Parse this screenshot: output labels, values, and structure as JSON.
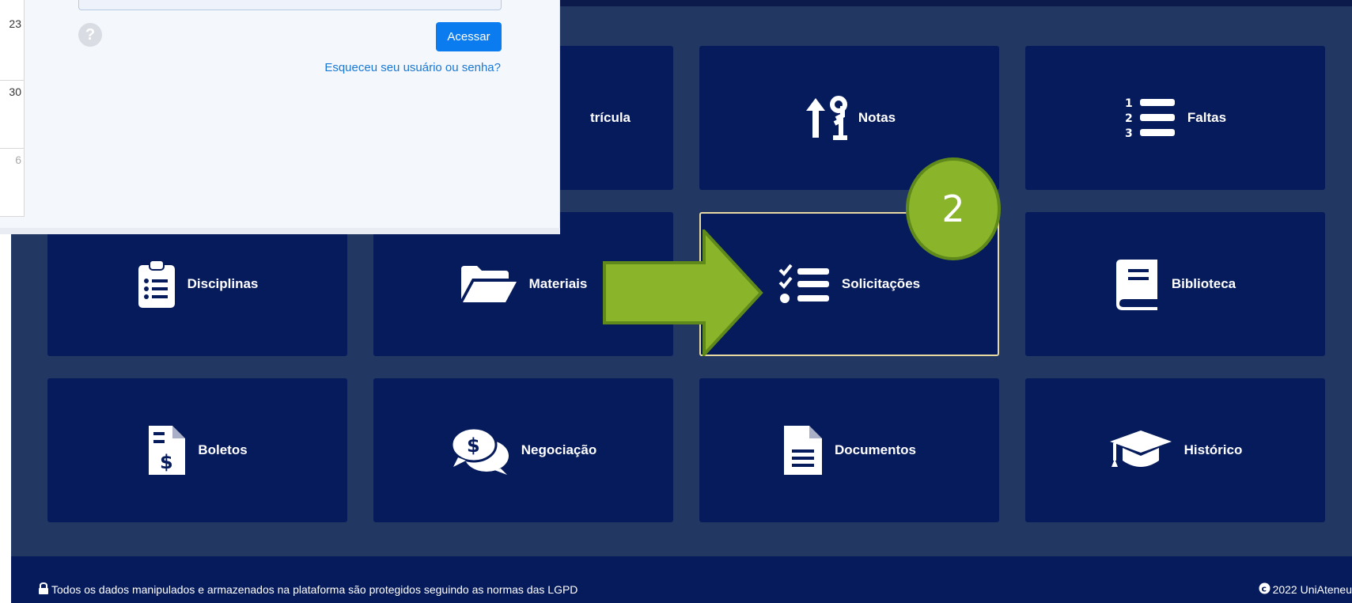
{
  "popup": {
    "calendar_days": [
      "23",
      "30",
      "6"
    ],
    "submit_label": "Acessar",
    "help_symbol": "?",
    "forgot_link": "Esqueceu seu usuário ou senha?"
  },
  "tiles": {
    "matricula": "trícula",
    "notas": "Notas",
    "faltas": "Faltas",
    "disciplinas": "Disciplinas",
    "materiais": "Materiais",
    "solicitacoes": "Solicitações",
    "biblioteca": "Biblioteca",
    "boletos": "Boletos",
    "negociacao": "Negociação",
    "documentos": "Documentos",
    "historico": "Histórico"
  },
  "annotation": {
    "step_number": "2",
    "color": "#8ab52a"
  },
  "footer": {
    "privacy_text": "Todos os dados manipulados e armazenados na plataforma são protegidos seguindo as normas das LGPD",
    "copyright_text": "2022 UniAteneu"
  },
  "colors": {
    "tile": "#061b5c",
    "background": "#223863",
    "button": "#0a7cf0",
    "link": "#1a78d6"
  }
}
